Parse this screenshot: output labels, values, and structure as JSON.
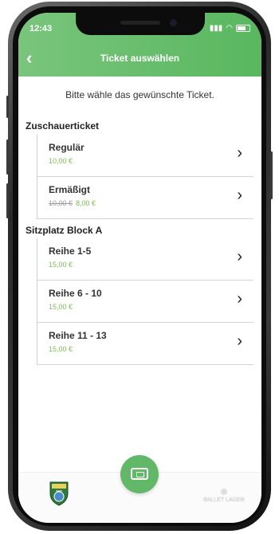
{
  "status": {
    "time": "12:43",
    "signal": "signal-icon",
    "wifi": "wifi-icon",
    "battery": "battery-icon"
  },
  "header": {
    "title": "Ticket auswählen",
    "back_icon": "back-chevron-icon",
    "gradient": [
      "#79c57c",
      "#59b75f"
    ]
  },
  "subtitle": "Bitte wähle das gewünschte Ticket.",
  "sections": [
    {
      "title": "Zuschauerticket",
      "items": [
        {
          "name": "Regulär",
          "price": "10,00 €"
        },
        {
          "name": "Ermäßigt",
          "old_price": "10,00 €",
          "price": "8,00 €"
        }
      ]
    },
    {
      "title": "Sitzplatz Block A",
      "items": [
        {
          "name": "Reihe 1-5",
          "price": "15,00 €"
        },
        {
          "name": "Reihe 6 - 10",
          "price": "15,00 €"
        },
        {
          "name": "Reihe 11 - 13",
          "price": "15,00 €"
        }
      ]
    }
  ],
  "tabbar": {
    "logo": "club-logo",
    "center": "ticket-icon",
    "right_label": "BALLET LAGER"
  },
  "colors": {
    "accent": "#61b869",
    "price": "#7bbf52"
  }
}
